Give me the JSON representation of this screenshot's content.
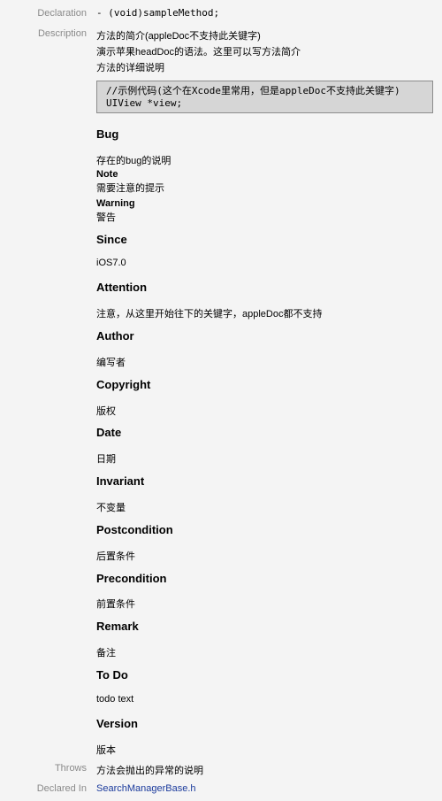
{
  "declaration": {
    "label": "Declaration",
    "value": "- (void)sampleMethod;"
  },
  "description": {
    "label": "Description",
    "lines": [
      "方法的简介(appleDoc不支持此关键字)",
      "演示苹果headDoc的语法。这里可以写方法简介",
      "方法的详细说明"
    ],
    "code": [
      "//示例代码(这个在Xcode里常用，但是appleDoc不支持此关键字)",
      "UIView *view;"
    ]
  },
  "sections": {
    "bug": {
      "title": "Bug",
      "text": "存在的bug的说明"
    },
    "note": {
      "title": "Note",
      "text": "需要注意的提示"
    },
    "warning": {
      "title": "Warning",
      "text": "警告"
    },
    "since": {
      "title": "Since",
      "text": "iOS7.0"
    },
    "attention": {
      "title": "Attention",
      "text": "注意，从这里开始往下的关键字，appleDoc都不支持"
    },
    "author": {
      "title": "Author",
      "text": "编写者"
    },
    "copyright": {
      "title": "Copyright",
      "text": "版权"
    },
    "date": {
      "title": "Date",
      "text": "日期"
    },
    "invariant": {
      "title": "Invariant",
      "text": "不变量"
    },
    "postcondition": {
      "title": "Postcondition",
      "text": "后置条件"
    },
    "precondition": {
      "title": "Precondition",
      "text": "前置条件"
    },
    "remark": {
      "title": "Remark",
      "text": "备注"
    },
    "todo": {
      "title": "To Do",
      "text": "todo text"
    },
    "version": {
      "title": "Version",
      "text": "版本"
    }
  },
  "throws": {
    "label": "Throws",
    "value": "方法会抛出的异常的说明"
  },
  "declared_in": {
    "label": "Declared In",
    "value": "SearchManagerBase.h"
  }
}
